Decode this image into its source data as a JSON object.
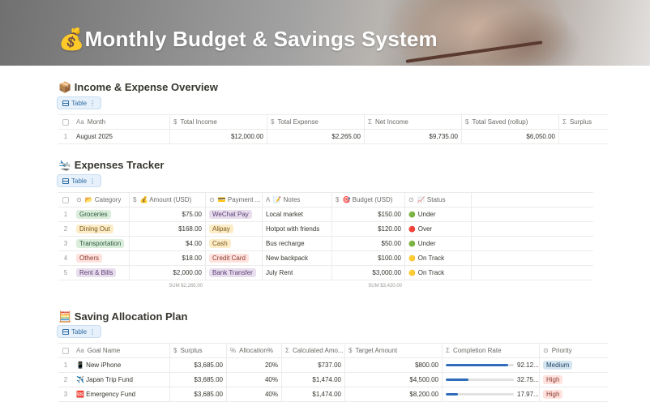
{
  "page": {
    "title": "💰Monthly Budget & Savings System"
  },
  "income_overview": {
    "title": "📦 Income & Expense Overview",
    "view_label": "Table",
    "columns": [
      "Month",
      "Total Income",
      "Total Expense",
      "Net Income",
      "Total Saved (rollup)",
      "Surplus"
    ],
    "column_icons": [
      "Aa",
      "$",
      "$",
      "Σ",
      "$",
      "Σ"
    ],
    "rows": [
      {
        "index": "1",
        "month": "August 2025",
        "total_income": "$12,000.00",
        "total_expense": "$2,265.00",
        "net_income": "$9,735.00",
        "total_saved": "$6,050.00",
        "surplus": ""
      }
    ]
  },
  "expenses": {
    "title": "🛬 Expenses Tracker",
    "view_label": "Table",
    "columns": [
      "📂 Category",
      "💰 Amount (USD)",
      "💳 Payment ...",
      "📝 Notes",
      "🎯 Budget (USD)",
      "📈 Status"
    ],
    "column_icons": [
      "⊙",
      "$",
      "⊙",
      "A",
      "$",
      "⊙"
    ],
    "rows": [
      {
        "index": "1",
        "category": "Groceries",
        "category_color": "#dbeddb",
        "category_text": "#2b593f",
        "amount": "$75.00",
        "payment": "WeChat Pay",
        "payment_color": "#e8deee",
        "payment_text": "#5a3c73",
        "notes": "Local market",
        "budget": "$150.00",
        "status_icon": "🟢",
        "status": "Under"
      },
      {
        "index": "2",
        "category": "Dining Out",
        "category_color": "#fdecc8",
        "category_text": "#7a5a1b",
        "amount": "$168.00",
        "payment": "Alipay",
        "payment_color": "#fdecc8",
        "payment_text": "#7a5a1b",
        "notes": "Hotpot with friends",
        "budget": "$120.00",
        "status_icon": "🔴",
        "status": "Over"
      },
      {
        "index": "3",
        "category": "Transportation",
        "category_color": "#dbeddb",
        "category_text": "#2b593f",
        "amount": "$4.00",
        "payment": "Cash",
        "payment_color": "#fdecc8",
        "payment_text": "#7a5a1b",
        "notes": "Bus recharge",
        "budget": "$50.00",
        "status_icon": "🟢",
        "status": "Under"
      },
      {
        "index": "4",
        "category": "Others",
        "category_color": "#ffe2dd",
        "category_text": "#8a3a2f",
        "amount": "$18.00",
        "payment": "Credit Card",
        "payment_color": "#ffe2dd",
        "payment_text": "#8a3a2f",
        "notes": "New backpack",
        "budget": "$100.00",
        "status_icon": "🟡",
        "status": "On Track"
      },
      {
        "index": "5",
        "category": "Rent & Bills",
        "category_color": "#e8deee",
        "category_text": "#5a3c73",
        "amount": "$2,000.00",
        "payment": "Bank Transfer",
        "payment_color": "#e8deee",
        "payment_text": "#5a3c73",
        "notes": "July Rent",
        "budget": "$3,000.00",
        "status_icon": "🟡",
        "status": "On Track"
      }
    ],
    "sum_amount": "SUM $2,265.00",
    "sum_budget": "SUM $3,420.00"
  },
  "saving_plan": {
    "title": "🧮 Saving Allocation Plan",
    "view_label": "Table",
    "columns": [
      "Goal Name",
      "Surplus",
      "Allocation%",
      "Calculated Amo...",
      "Target Amount",
      "Completion Rate",
      "Priority"
    ],
    "column_icons": [
      "Aa",
      "$",
      "%",
      "Σ",
      "$",
      "Σ",
      "⊙"
    ],
    "rows": [
      {
        "index": "1",
        "goal": "📱 New iPhone",
        "surplus": "$3,685.00",
        "allocation": "20%",
        "calculated": "$737.00",
        "target": "$800.00",
        "completion": 0.92,
        "completion_text": "92.12...",
        "priority": "Medium",
        "priority_color": "#d3e5ef",
        "priority_text": "#28456c"
      },
      {
        "index": "2",
        "goal": "✈️ Japan Trip Fund",
        "surplus": "$3,685.00",
        "allocation": "40%",
        "calculated": "$1,474.00",
        "target": "$4,500.00",
        "completion": 0.33,
        "completion_text": "32.75...",
        "priority": "High",
        "priority_color": "#ffe2dd",
        "priority_text": "#8a3a2f"
      },
      {
        "index": "3",
        "goal": "🆘 Emergency Fund",
        "surplus": "$3,685.00",
        "allocation": "40%",
        "calculated": "$1,474.00",
        "target": "$8,200.00",
        "completion": 0.18,
        "completion_text": "17.97...",
        "priority": "High",
        "priority_color": "#ffe2dd",
        "priority_text": "#8a3a2f"
      }
    ]
  }
}
